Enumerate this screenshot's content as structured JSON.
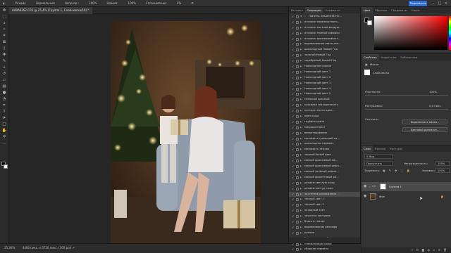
{
  "options_bar": {
    "mode_label": "Режим:",
    "mode_value": "Нормальный",
    "opacity_label": "Непрозр.:",
    "opacity_value": "100%",
    "flow_label": "Нажим:",
    "flow_value": "100%",
    "smoothing_label": "Сглаживание:",
    "smoothing_value": "0%",
    "share_label": "Поделиться"
  },
  "document_tab": {
    "title": "AVBA8362.CR3 @ 25,4% (Группа 1, Слой-маска/16) *"
  },
  "status_bar": {
    "zoom": "25,36%",
    "doc_info": "4480 пикс. x 6720 пикс. (300 ppi) >"
  },
  "actions_panel": {
    "tabs": [
      "История",
      "Операции",
      "Комменты"
    ],
    "active_tab": "Операции",
    "folder": "ПАНЕЛЬ ЭКШЕНОВ НО...",
    "items": [
      "отключи нерезкостного...",
      "отключи светлой воздуш...",
      "отключи темной коморки",
      "отключи оранжевый вст...",
      "выравнивание свето-тен...",
      "шоколадный Новый Год",
      "золотой Новый Год",
      "серебряный Новый Год",
      "Новогоднее сияние",
      "Новогодний цвет 1",
      "Новогодний цвет 2",
      "Новогодний цвет 3",
      "Новогодний цвет 4",
      "Новогодний цвет 5",
      "снежный красный",
      "красивая насыщенность",
      "контрастность одно...",
      "цвет кожи",
      "глубина цвета",
      "микроконтраст",
      "виньетирование",
      "матовость (меньший ко...",
      "шоколадная гармонь",
      "матовость тёплая",
      "теплый белый цвет",
      "мягкий оранжевый эф...",
      "мягкий оранжевый рефл...",
      "мягкий зелёный рефле...",
      "мягкий фиолетовый ре...",
      "делаем светлую кожу",
      "делаем контур кожи",
      "частотное разложение ...",
      "тёплый свет 1",
      "тёплый свет 2",
      "холодный свет",
      "зачистка контуров",
      "блеск в глазах",
      "выравнивание рельефа",
      "румяна",
      "белоснежные зубы",
      "стабилизация кожи",
      "убираем герметы",
      "убираем лишние тени",
      "объем"
    ],
    "highlighted_index": 31
  },
  "color_panel": {
    "tabs": [
      "Цвет",
      "Образцы",
      "Градиенты",
      "Узоры"
    ],
    "active_tab": "Цвет",
    "foreground": "#000000",
    "background": "#ffffff",
    "hue": "#ff0000"
  },
  "properties_panel": {
    "tabs": [
      "Свойства",
      "Коррекция",
      "Библиотеки"
    ],
    "active_tab": "Свойства",
    "mask_header": "Маски",
    "mask_type": "Слой-маска",
    "density_label": "Плотность:",
    "density_value": "100%",
    "feather_label": "Растушевка:",
    "feather_value": "0,0 пикс.",
    "refine_label": "Уточнить:",
    "select_mask_button": "Выделение и маска...",
    "color_range_button": "Цветовой диапазон..."
  },
  "layers_panel": {
    "tabs": [
      "Слои",
      "Каналы",
      "Контуры"
    ],
    "active_tab": "Слои",
    "filter_kind": "Вид",
    "blend_mode": "Пропустить",
    "opacity_label": "Непрозрачность:",
    "opacity_value": "100%",
    "lock_label": "Закрепить:",
    "fill_label": "Заливка:",
    "fill_value": "100%",
    "layers": [
      {
        "name": "Группа 1",
        "selected": true,
        "type": "group"
      },
      {
        "name": "Фон",
        "selected": false,
        "type": "image"
      }
    ]
  },
  "icons": {
    "tools": [
      "move-icon",
      "marquee-icon",
      "lasso-icon",
      "magic-wand-icon",
      "crop-icon",
      "frame-icon",
      "eyedropper-icon",
      "healing-brush-icon",
      "brush-icon",
      "clone-stamp-icon",
      "history-brush-icon",
      "eraser-icon",
      "gradient-icon",
      "blur-icon",
      "dodge-icon",
      "pen-icon",
      "type-icon",
      "path-select-icon",
      "rectangle-icon",
      "hand-icon",
      "zoom-icon",
      "more-tools-icon"
    ]
  }
}
